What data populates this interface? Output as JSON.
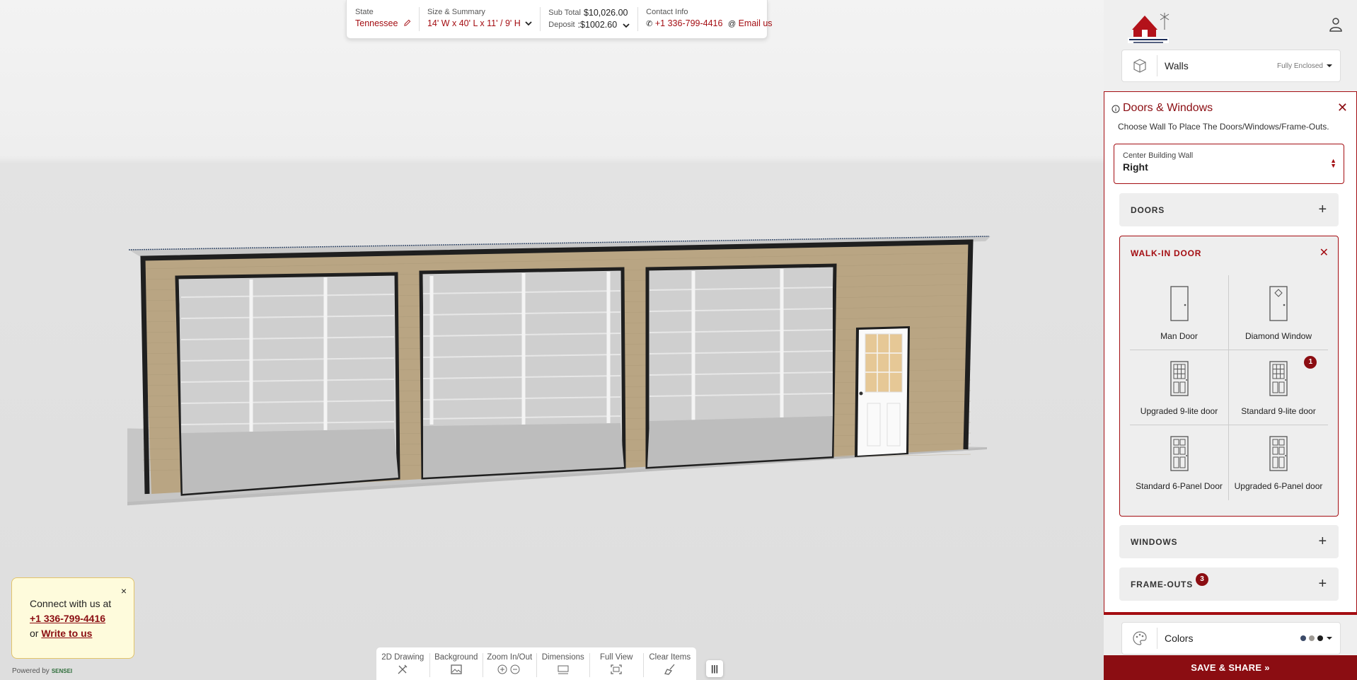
{
  "topbar": {
    "state": {
      "label": "State",
      "value": "Tennessee"
    },
    "size": {
      "label": "Size & Summary",
      "value": "14' W x 40' L x 11' / 9' H"
    },
    "pricing": {
      "subtotal_label": "Sub Total",
      "subtotal_value": "$10,026.00",
      "deposit_label": "Deposit",
      "deposit_value": ":$1002.60"
    },
    "contact": {
      "label": "Contact Info",
      "phone": "+1 336-799-4416",
      "email": "Email us"
    }
  },
  "toolbar": {
    "items": [
      {
        "label": "2D Drawing",
        "icon": "drawing-icon"
      },
      {
        "label": "Background",
        "icon": "image-icon"
      },
      {
        "label": "Zoom In/Out",
        "icon": "zoom-icon"
      },
      {
        "label": "Dimensions",
        "icon": "dimensions-icon"
      },
      {
        "label": "Full View",
        "icon": "fullscreen-icon"
      },
      {
        "label": "Clear Items",
        "icon": "broom-icon"
      }
    ],
    "extra": "|||"
  },
  "connect": {
    "line1": "Connect with us at",
    "phone": "+1 336-799-4416",
    "or": "or",
    "write": "Write to us",
    "close": "×"
  },
  "powered": {
    "text": "Powered by",
    "brand": "SENSEI"
  },
  "sidebar": {
    "walls": {
      "label": "Walls",
      "value": "Fully Enclosed"
    },
    "colors": {
      "label": "Colors",
      "swatches": [
        "#3b4a68",
        "#9e9a94",
        "#1d1d1d"
      ]
    },
    "save": "SAVE & SHARE »"
  },
  "doors_windows": {
    "title": "Doors & Windows",
    "subtitle": "Choose Wall To Place The Doors/Windows/Frame-Outs.",
    "wall_select": {
      "label": "Center Building Wall",
      "value": "Right"
    },
    "sections": {
      "doors": "DOORS",
      "walkin": "WALK-IN DOOR",
      "windows": "WINDOWS",
      "frameouts": "FRAME-OUTS",
      "frameouts_badge": "3"
    },
    "door_options": [
      {
        "name": "Man Door",
        "icon": "man-door-icon"
      },
      {
        "name": "Diamond Window",
        "icon": "diamond-window-door-icon"
      },
      {
        "name": "Upgraded 9-lite door",
        "icon": "nine-lite-door-icon"
      },
      {
        "name": "Standard 9-lite door",
        "icon": "nine-lite-door-icon",
        "badge": "1"
      },
      {
        "name": "Standard 6-Panel Door",
        "icon": "six-panel-door-icon"
      },
      {
        "name": "Upgraded 6-Panel door",
        "icon": "six-panel-door-icon"
      }
    ]
  },
  "colors": {
    "accent": "#a40d12",
    "accent_dark": "#8b0d12",
    "wall_tan": "#b9a583",
    "trim": "#1f1f1f"
  }
}
